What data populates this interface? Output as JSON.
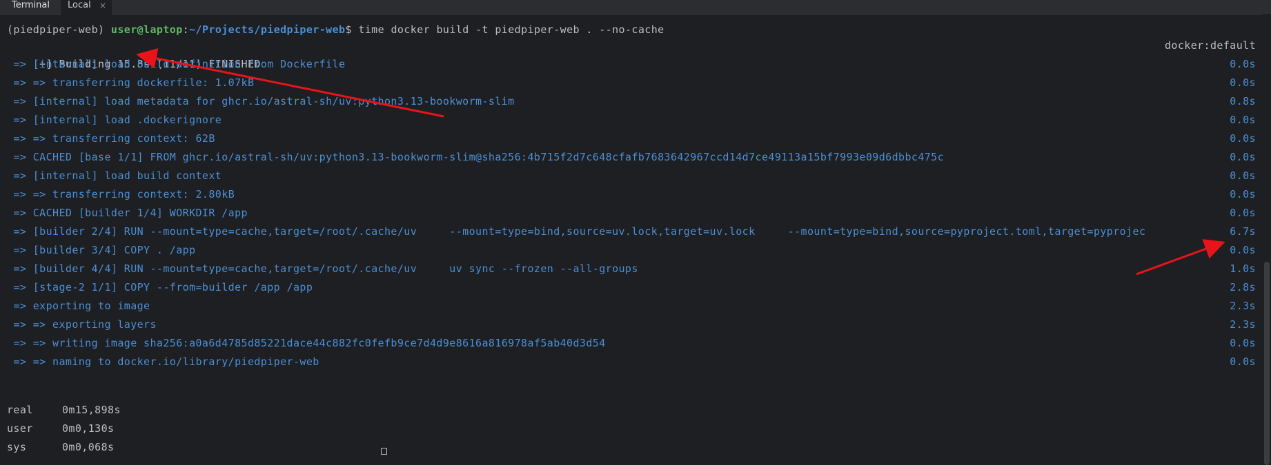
{
  "tabs": {
    "terminal": "Terminal",
    "local": "Local",
    "close_glyph": "×"
  },
  "prompt": {
    "env": "(piedpiper-web) ",
    "user_host": "user@laptop",
    "colon": ":",
    "path": "~/Projects/piedpiper-web",
    "dollar": "$ ",
    "command": "time docker build -t piedpiper-web . --no-cache"
  },
  "build_header": {
    "text": "[+] Building 15.8s (11/11) FINISHED",
    "context": "docker:default"
  },
  "steps": [
    {
      "text": "=> [internal] load build definition from Dockerfile",
      "time": "0.0s"
    },
    {
      "text": "=> => transferring dockerfile: 1.07kB",
      "time": "0.0s"
    },
    {
      "text": "=> [internal] load metadata for ghcr.io/astral-sh/uv:python3.13-bookworm-slim",
      "time": "0.8s"
    },
    {
      "text": "=> [internal] load .dockerignore",
      "time": "0.0s"
    },
    {
      "text": "=> => transferring context: 62B",
      "time": "0.0s"
    },
    {
      "text": "=> CACHED [base 1/1] FROM ghcr.io/astral-sh/uv:python3.13-bookworm-slim@sha256:4b715f2d7c648cfafb7683642967ccd14d7ce49113a15bf7993e09d6dbbc475c",
      "time": "0.0s"
    },
    {
      "text": "=> [internal] load build context",
      "time": "0.0s"
    },
    {
      "text": "=> => transferring context: 2.80kB",
      "time": "0.0s"
    },
    {
      "text": "=> CACHED [builder 1/4] WORKDIR /app",
      "time": "0.0s"
    },
    {
      "text": "=> [builder 2/4] RUN --mount=type=cache,target=/root/.cache/uv     --mount=type=bind,source=uv.lock,target=uv.lock     --mount=type=bind,source=pyproject.toml,target=pyprojec",
      "time": "6.7s"
    },
    {
      "text": "=> [builder 3/4] COPY . /app",
      "time": "0.0s"
    },
    {
      "text": "=> [builder 4/4] RUN --mount=type=cache,target=/root/.cache/uv     uv sync --frozen --all-groups",
      "time": "1.0s"
    },
    {
      "text": "=> [stage-2 1/1] COPY --from=builder /app /app",
      "time": "2.8s"
    },
    {
      "text": "=> exporting to image",
      "time": "2.3s"
    },
    {
      "text": "=> => exporting layers",
      "time": "2.3s"
    },
    {
      "text": "=> => writing image sha256:a0a6d4785d85221dace44c882fc0fefb9ce7d4d9e8616a816978af5ab40d3d54",
      "time": "0.0s"
    },
    {
      "text": "=> => naming to docker.io/library/piedpiper-web",
      "time": "0.0s"
    }
  ],
  "timing": [
    {
      "label": "real",
      "value": "0m15,898s"
    },
    {
      "label": "user",
      "value": "0m0,130s"
    },
    {
      "label": "sys",
      "value": "0m0,068s"
    }
  ],
  "colors": {
    "background": "#1e1f22",
    "text": "#bcbec4",
    "step_blue": "#4a8fd6",
    "user_green": "#5fb865",
    "arrow_red": "#e8141a"
  }
}
